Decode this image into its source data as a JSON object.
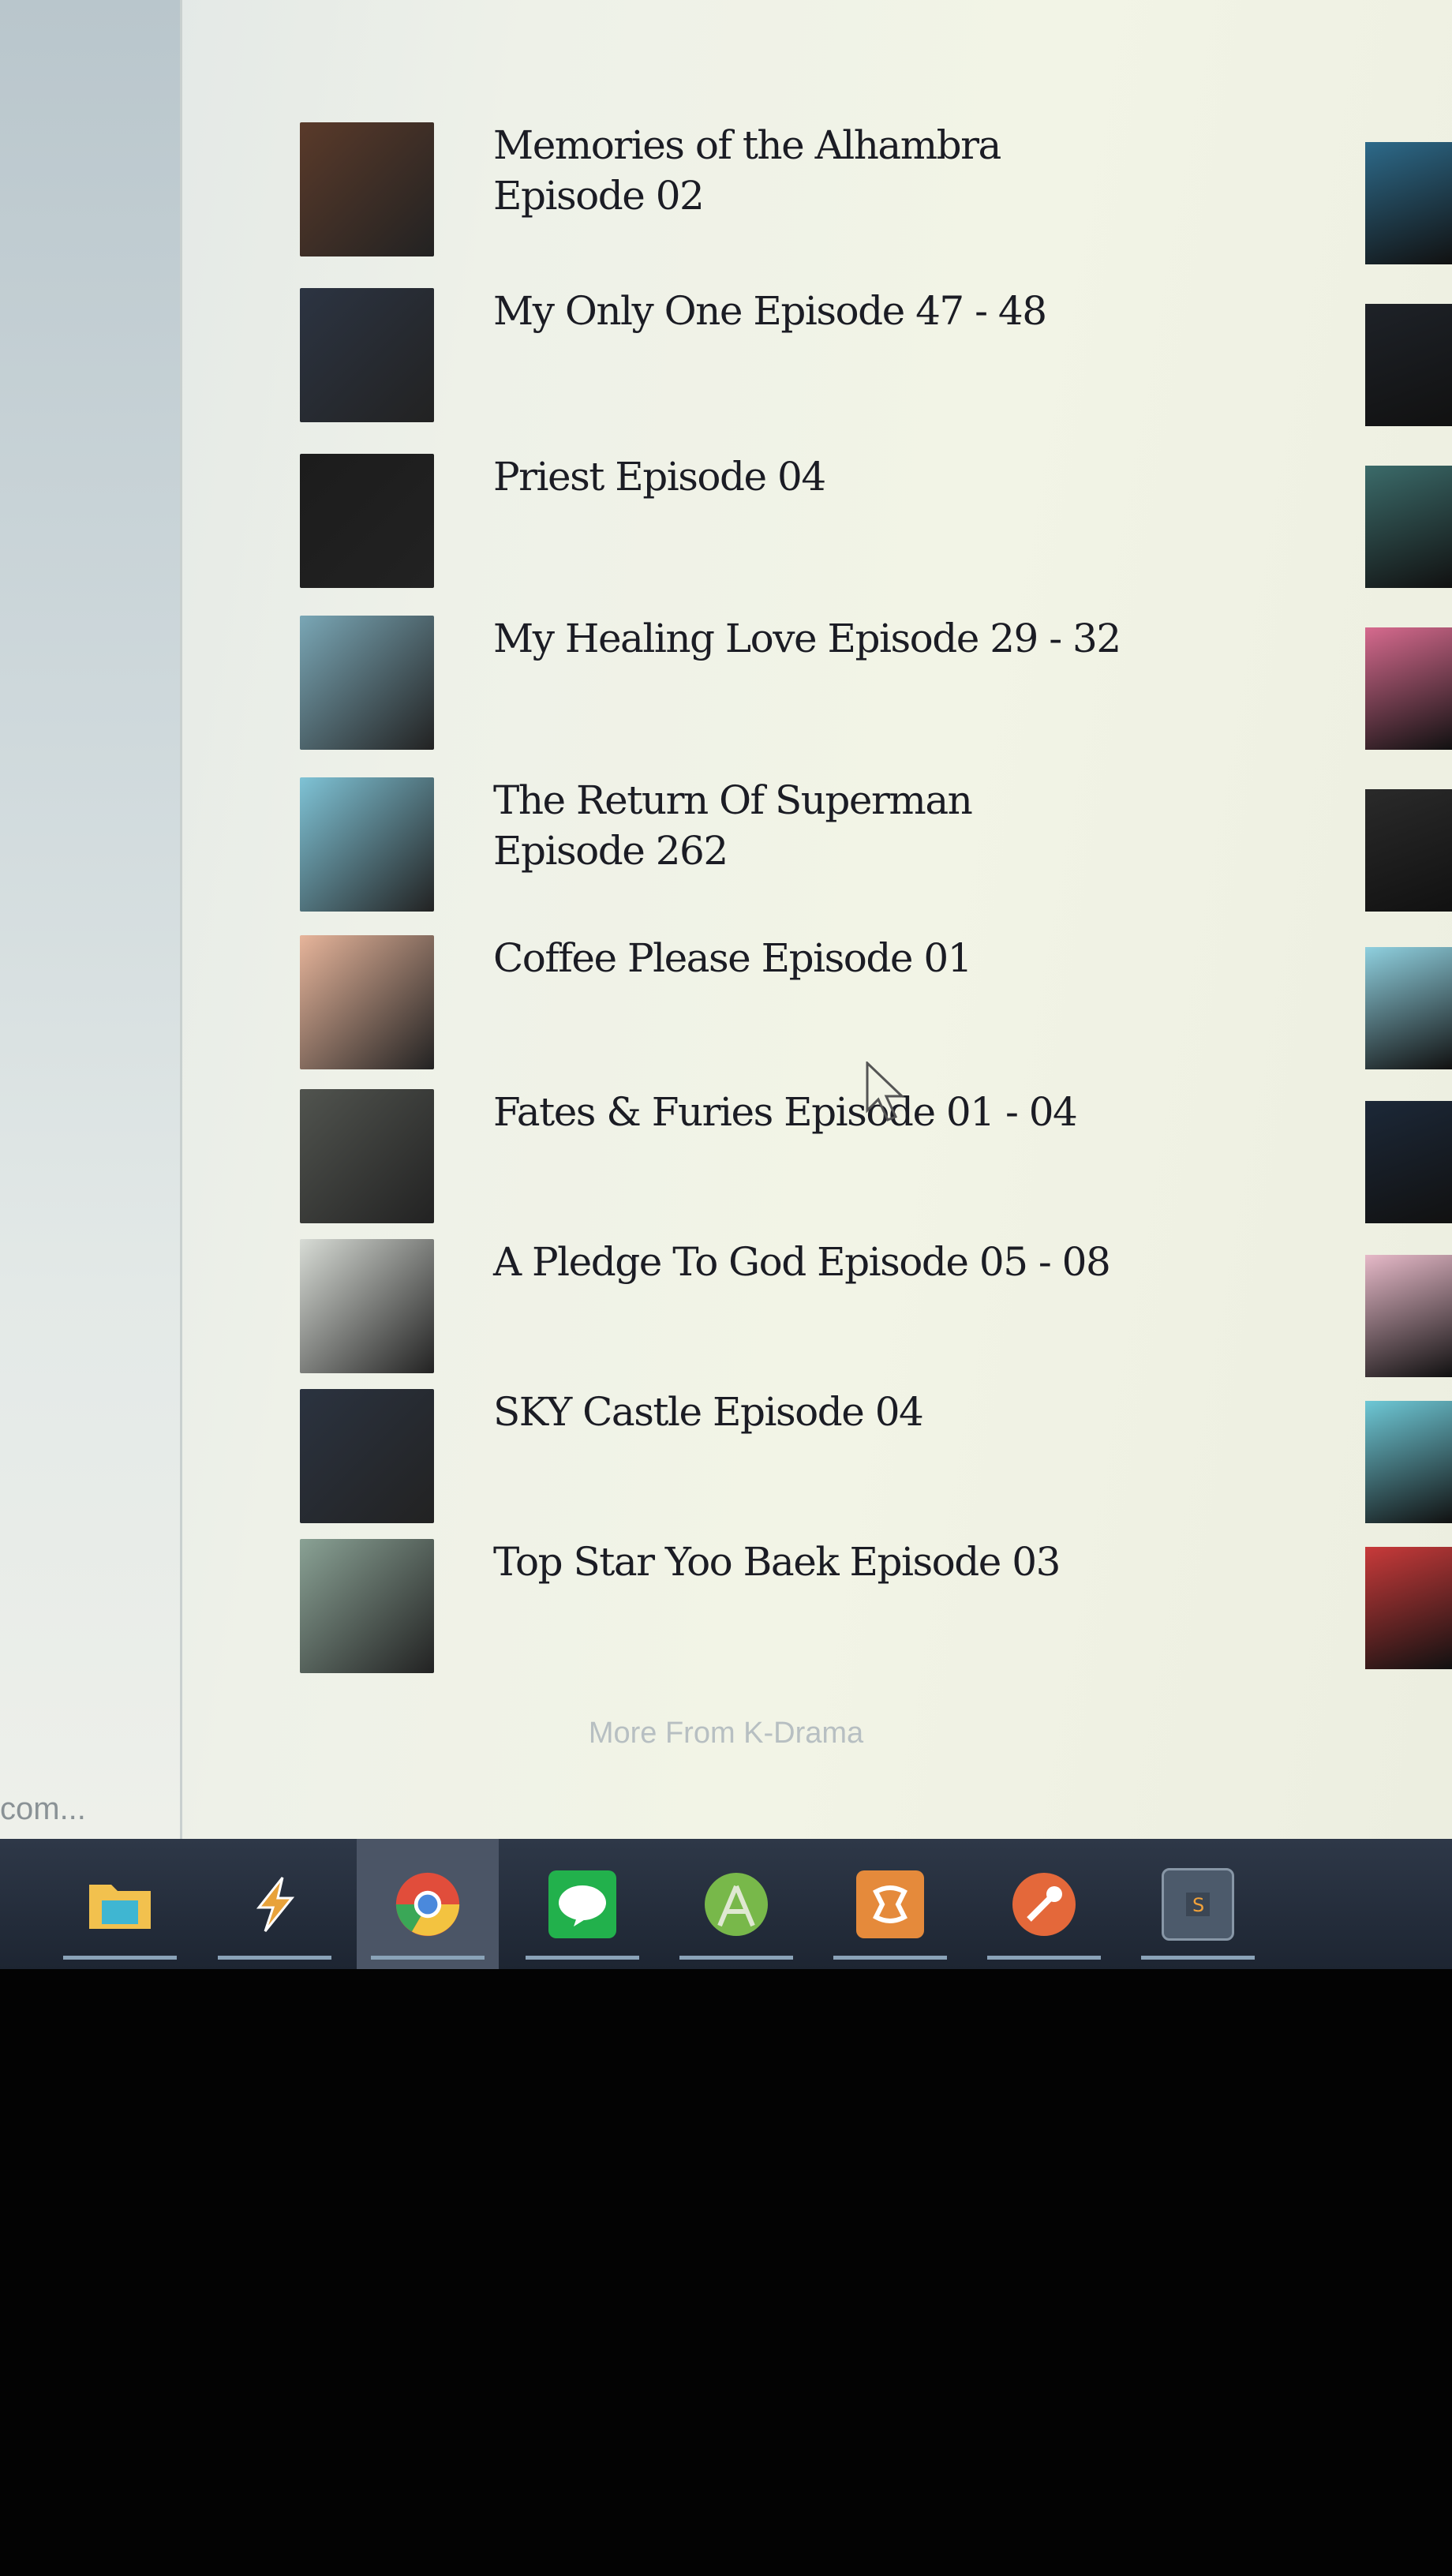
{
  "related": {
    "items": [
      {
        "title": "Memories of the Alhambra Episode 02",
        "thumb_color": "#5a3a2a"
      },
      {
        "title": "My Only One Episode 47 - 48",
        "thumb_color": "#2c3442"
      },
      {
        "title": "Priest Episode 04",
        "thumb_color": "#1c1c1c"
      },
      {
        "title": "My Healing Love Episode 29 - 32",
        "thumb_color": "#7aa7b6"
      },
      {
        "title": "The Return Of Superman Episode 262",
        "thumb_color": "#7fc3d6"
      },
      {
        "title": "Coffee Please Episode 01",
        "thumb_color": "#e7b59b"
      },
      {
        "title": "Fates & Furies Episode 01 - 04",
        "thumb_color": "#51544f"
      },
      {
        "title": "A Pledge To God Episode 05 - 08",
        "thumb_color": "#d8dcd6"
      },
      {
        "title": "SKY Castle Episode 04",
        "thumb_color": "#2b3340"
      },
      {
        "title": "Top Star Yoo Baek Episode 03",
        "thumb_color": "#8aa295"
      }
    ],
    "more_label": "More From K-Drama"
  },
  "right_thumbs": [
    "#2d6a8a",
    "#1e2228",
    "#3b6b6a",
    "#d66a8e",
    "#2a2a2a",
    "#8fd0df",
    "#1c2838",
    "#e6b9c8",
    "#6ec8d6",
    "#c83a3a"
  ],
  "status_bar": {
    "url_text": "com..."
  },
  "taskbar": {
    "items": [
      {
        "name": "File Explorer",
        "icon": "folder-icon",
        "color": "#3fb6d2"
      },
      {
        "name": "Winamp",
        "icon": "winamp-icon",
        "color": "#e8a23a"
      },
      {
        "name": "Chrome",
        "icon": "chrome-icon",
        "color": "#e14d3b"
      },
      {
        "name": "LINE",
        "icon": "line-icon",
        "color": "#22b14c"
      },
      {
        "name": "Android Studio",
        "icon": "android-studio-icon",
        "color": "#78b84a"
      },
      {
        "name": "XAMPP",
        "icon": "xampp-icon",
        "color": "#e58a3b"
      },
      {
        "name": "Postman",
        "icon": "postman-icon",
        "color": "#e4683a"
      },
      {
        "name": "Sublime Text",
        "icon": "sublime-icon",
        "color": "#4c5a6b"
      }
    ]
  }
}
